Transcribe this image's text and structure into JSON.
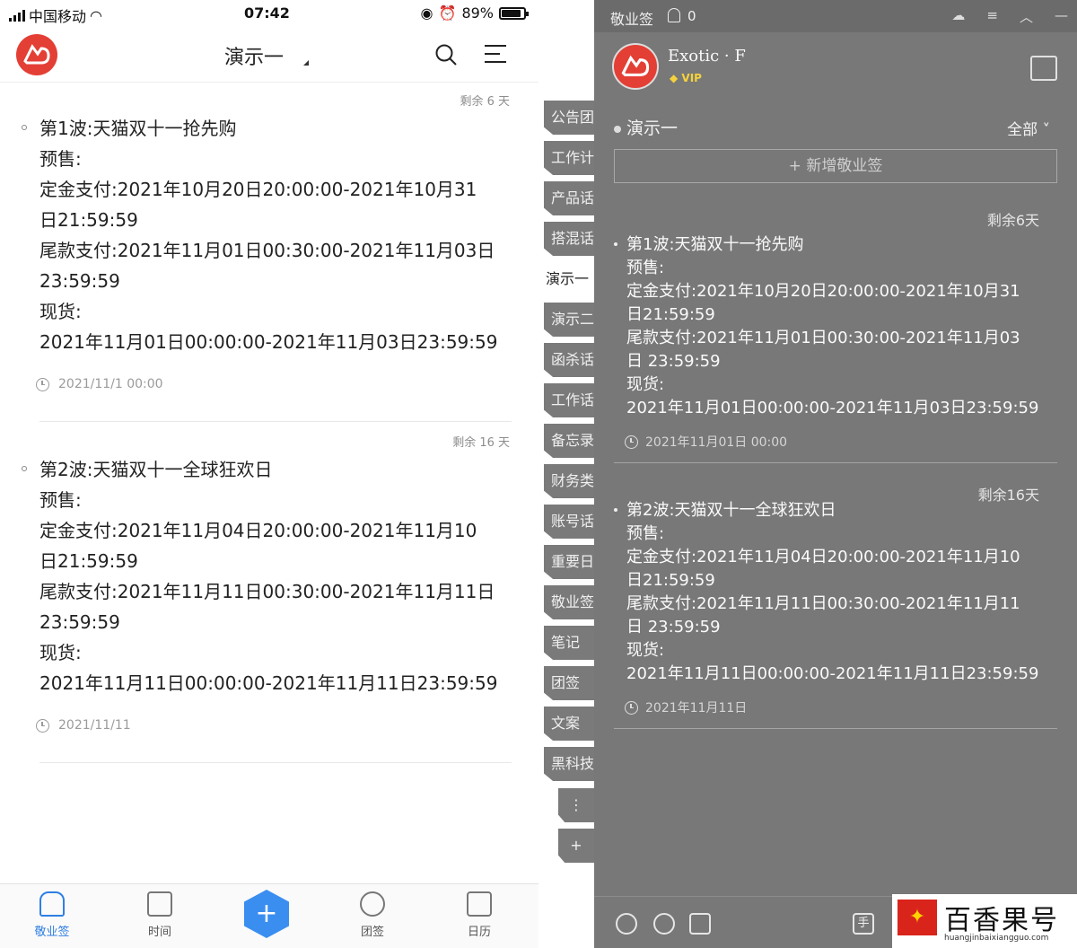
{
  "mobile": {
    "status": {
      "carrier": "中国移动",
      "time": "07:42",
      "battery": "89%",
      "battery_level": 0.89
    },
    "header": {
      "title": "演示一"
    },
    "cards": [
      {
        "remain": "剩余 6 天",
        "lines": [
          "第1波:天猫双十一抢先购",
          "预售:",
          "定金支付:2021年10月20日20:00:00-2021年10月31",
          "日21:59:59",
          "尾款支付:2021年11月01日00:30:00-2021年11月03日",
          "23:59:59",
          "现货:",
          "2021年11月01日00:00:00-2021年11月03日23:59:59"
        ],
        "date": "2021/11/1 00:00"
      },
      {
        "remain": "剩余 16 天",
        "lines": [
          "第2波:天猫双十一全球狂欢日",
          "预售:",
          "定金支付:2021年11月04日20:00:00-2021年11月10",
          "日21:59:59",
          "尾款支付:2021年11月11日00:30:00-2021年11月11日",
          "23:59:59",
          "现货:",
          "2021年11月11日00:00:00-2021年11月11日23:59:59"
        ],
        "date": "2021/11/11"
      }
    ],
    "tabs": [
      "敬业签",
      "时间",
      "团签",
      "日历"
    ],
    "plus": "+"
  },
  "vtabs": [
    "公告团",
    "工作计",
    "产品话",
    "搭混话",
    "演示一",
    "演示二",
    "函杀话",
    "工作话",
    "备忘录",
    "财务类",
    "账号话",
    "重要日",
    "敬业签",
    "笔记",
    "团签",
    "文案",
    "黑科技"
  ],
  "vtab_more": "⋮",
  "vtab_add": "+",
  "desktop": {
    "app_name": "敬业签",
    "notify_count": "0",
    "user": "Exotic · F",
    "vip": "VIP",
    "filter": "演示一",
    "filter_all": "全部 ˅",
    "new_note": "+ 新增敬业签",
    "cards": [
      {
        "remain": "剩余6天",
        "lines": [
          "第1波:天猫双十一抢先购",
          "预售:",
          "定金支付:2021年10月20日20:00:00-2021年10月31",
          "日21:59:59",
          "尾款支付:2021年11月01日00:30:00-2021年11月03",
          "日 23:59:59",
          "现货:",
          "2021年11月01日00:00:00-2021年11月03日23:59:59"
        ],
        "date": "2021年11月01日 00:00"
      },
      {
        "remain": "剩余16天",
        "lines": [
          "第2波:天猫双十一全球狂欢日",
          "预售:",
          "定金支付:2021年11月04日20:00:00-2021年11月10",
          "日21:59:59",
          "尾款支付:2021年11月11日00:30:00-2021年11月11",
          "日 23:59:59",
          "现货:",
          "2021年11月11日00:00:00-2021年11月11日23:59:59"
        ],
        "date": "2021年11月11日"
      }
    ],
    "bottom_icon_label": "手"
  },
  "watermark": {
    "text": "百香果号",
    "url": "huangjinbaixiangguo.com"
  },
  "colors": {
    "accent": "#3a8ef0",
    "brand_red": "#e33f35",
    "desktop_bg": "#787878"
  }
}
